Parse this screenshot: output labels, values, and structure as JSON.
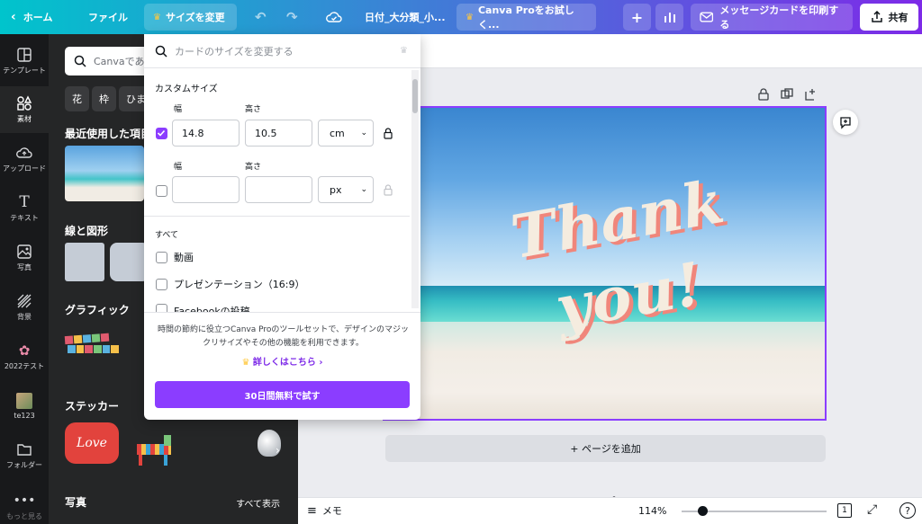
{
  "topbar": {
    "home": "ホーム",
    "file": "ファイル",
    "resize": "サイズを変更",
    "doc_title": "日付_大分類_小...",
    "pro_trial": "Canva Proをお試しく...",
    "print_cards": "メッセージカードを印刷する",
    "share": "共有"
  },
  "rail": {
    "items": [
      {
        "label": "テンプレート",
        "icon": "template-icon"
      },
      {
        "label": "素材",
        "icon": "elements-icon"
      },
      {
        "label": "アップロード",
        "icon": "upload-icon"
      },
      {
        "label": "テキスト",
        "icon": "text-icon"
      },
      {
        "label": "写真",
        "icon": "photo-icon"
      },
      {
        "label": "背景",
        "icon": "background-icon"
      },
      {
        "label": "2022テスト",
        "icon": "flower-icon"
      },
      {
        "label": "te123",
        "icon": "folder-thumb-icon"
      },
      {
        "label": "フォルダー",
        "icon": "folder-icon"
      },
      {
        "label": "もっと見る",
        "icon": "more-icon"
      }
    ]
  },
  "panel": {
    "search_placeholder": "Canvaであ",
    "chips": [
      "花",
      "枠",
      "ひま"
    ],
    "recent_title": "最近使用した項目",
    "lines_title": "線と図形",
    "graphics_title": "グラフィック",
    "stickers_title": "ステッカー",
    "sticker_love": "Love",
    "photos_title": "写真",
    "see_all": "すべて表示"
  },
  "dropdown": {
    "search_placeholder": "カードのサイズを変更する",
    "custom_size": "カスタムサイズ",
    "width_label": "幅",
    "height_label": "高さ",
    "row1": {
      "width": "14.8",
      "height": "10.5",
      "unit": "cm"
    },
    "row2": {
      "width": "",
      "height": "",
      "unit": "px"
    },
    "all_label": "すべて",
    "options": [
      "動画",
      "プレゼンテーション（16:9）",
      "Facebookの投稿"
    ],
    "promo_text": "時間の節約に役立つCanva Proのツールセットで、デザインのマジックリサイズやその他の機能を利用できます。",
    "learn_more": "詳しくはこちら ›",
    "try_button": "30日間無料で試す"
  },
  "canvas": {
    "thank": "Thank",
    "you": "you!",
    "add_page": "+ ページを追加"
  },
  "bottombar": {
    "notes": "メモ",
    "zoom": "114%",
    "zoom_fraction": 0.14,
    "page_count": "1",
    "help": "?"
  },
  "colors": {
    "accent": "#8b3dff",
    "gradient_start": "#00c4cc",
    "gradient_end": "#7d2ae8",
    "panel": "#252627",
    "rail": "#18191b"
  }
}
